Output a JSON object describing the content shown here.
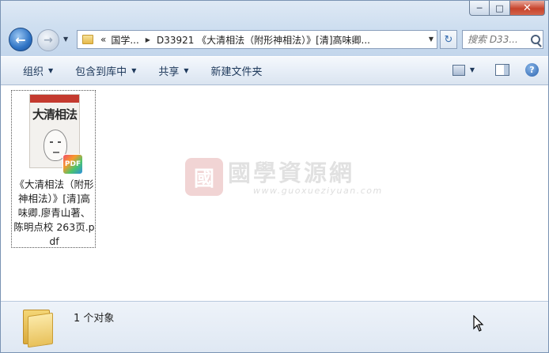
{
  "window": {
    "minimize_glyph": "─",
    "maximize_glyph": "□",
    "close_glyph": "✕"
  },
  "nav": {
    "back_glyph": "←",
    "forward_glyph": "→",
    "history_glyph": "▼"
  },
  "address": {
    "overflow": "«",
    "crumb1": "国学...",
    "crumb2": "D33921 《大清相法（附形神相法）》[清]高味卿...",
    "sep": "▶",
    "dropdown": "▼"
  },
  "refresh_glyph": "↻",
  "search": {
    "placeholder": "搜索 D33..."
  },
  "toolbar": {
    "organize": "组织",
    "include_library": "包含到库中",
    "share": "共享",
    "new_folder": "新建文件夹",
    "arrow": "▼",
    "help_glyph": "?"
  },
  "file": {
    "name": "《大清相法（附形神相法）》[清]高味卿.廖青山著、陈明点校 263页.pdf",
    "badge": "PDF",
    "cover_title": "大清相法"
  },
  "watermark": {
    "logo": "國",
    "cn": "國學資源網",
    "en": "www.guoxueziyuan.com"
  },
  "status": {
    "count": "1 个对象"
  },
  "icons": {
    "back": "back-arrow-icon",
    "forward": "forward-arrow-icon",
    "folder": "folder-icon",
    "refresh": "refresh-icon",
    "search": "search-icon",
    "views": "view-options-icon",
    "preview_pane": "preview-pane-icon",
    "help": "help-icon",
    "pdf": "pdf-file-icon",
    "cursor": "mouse-cursor-icon"
  }
}
